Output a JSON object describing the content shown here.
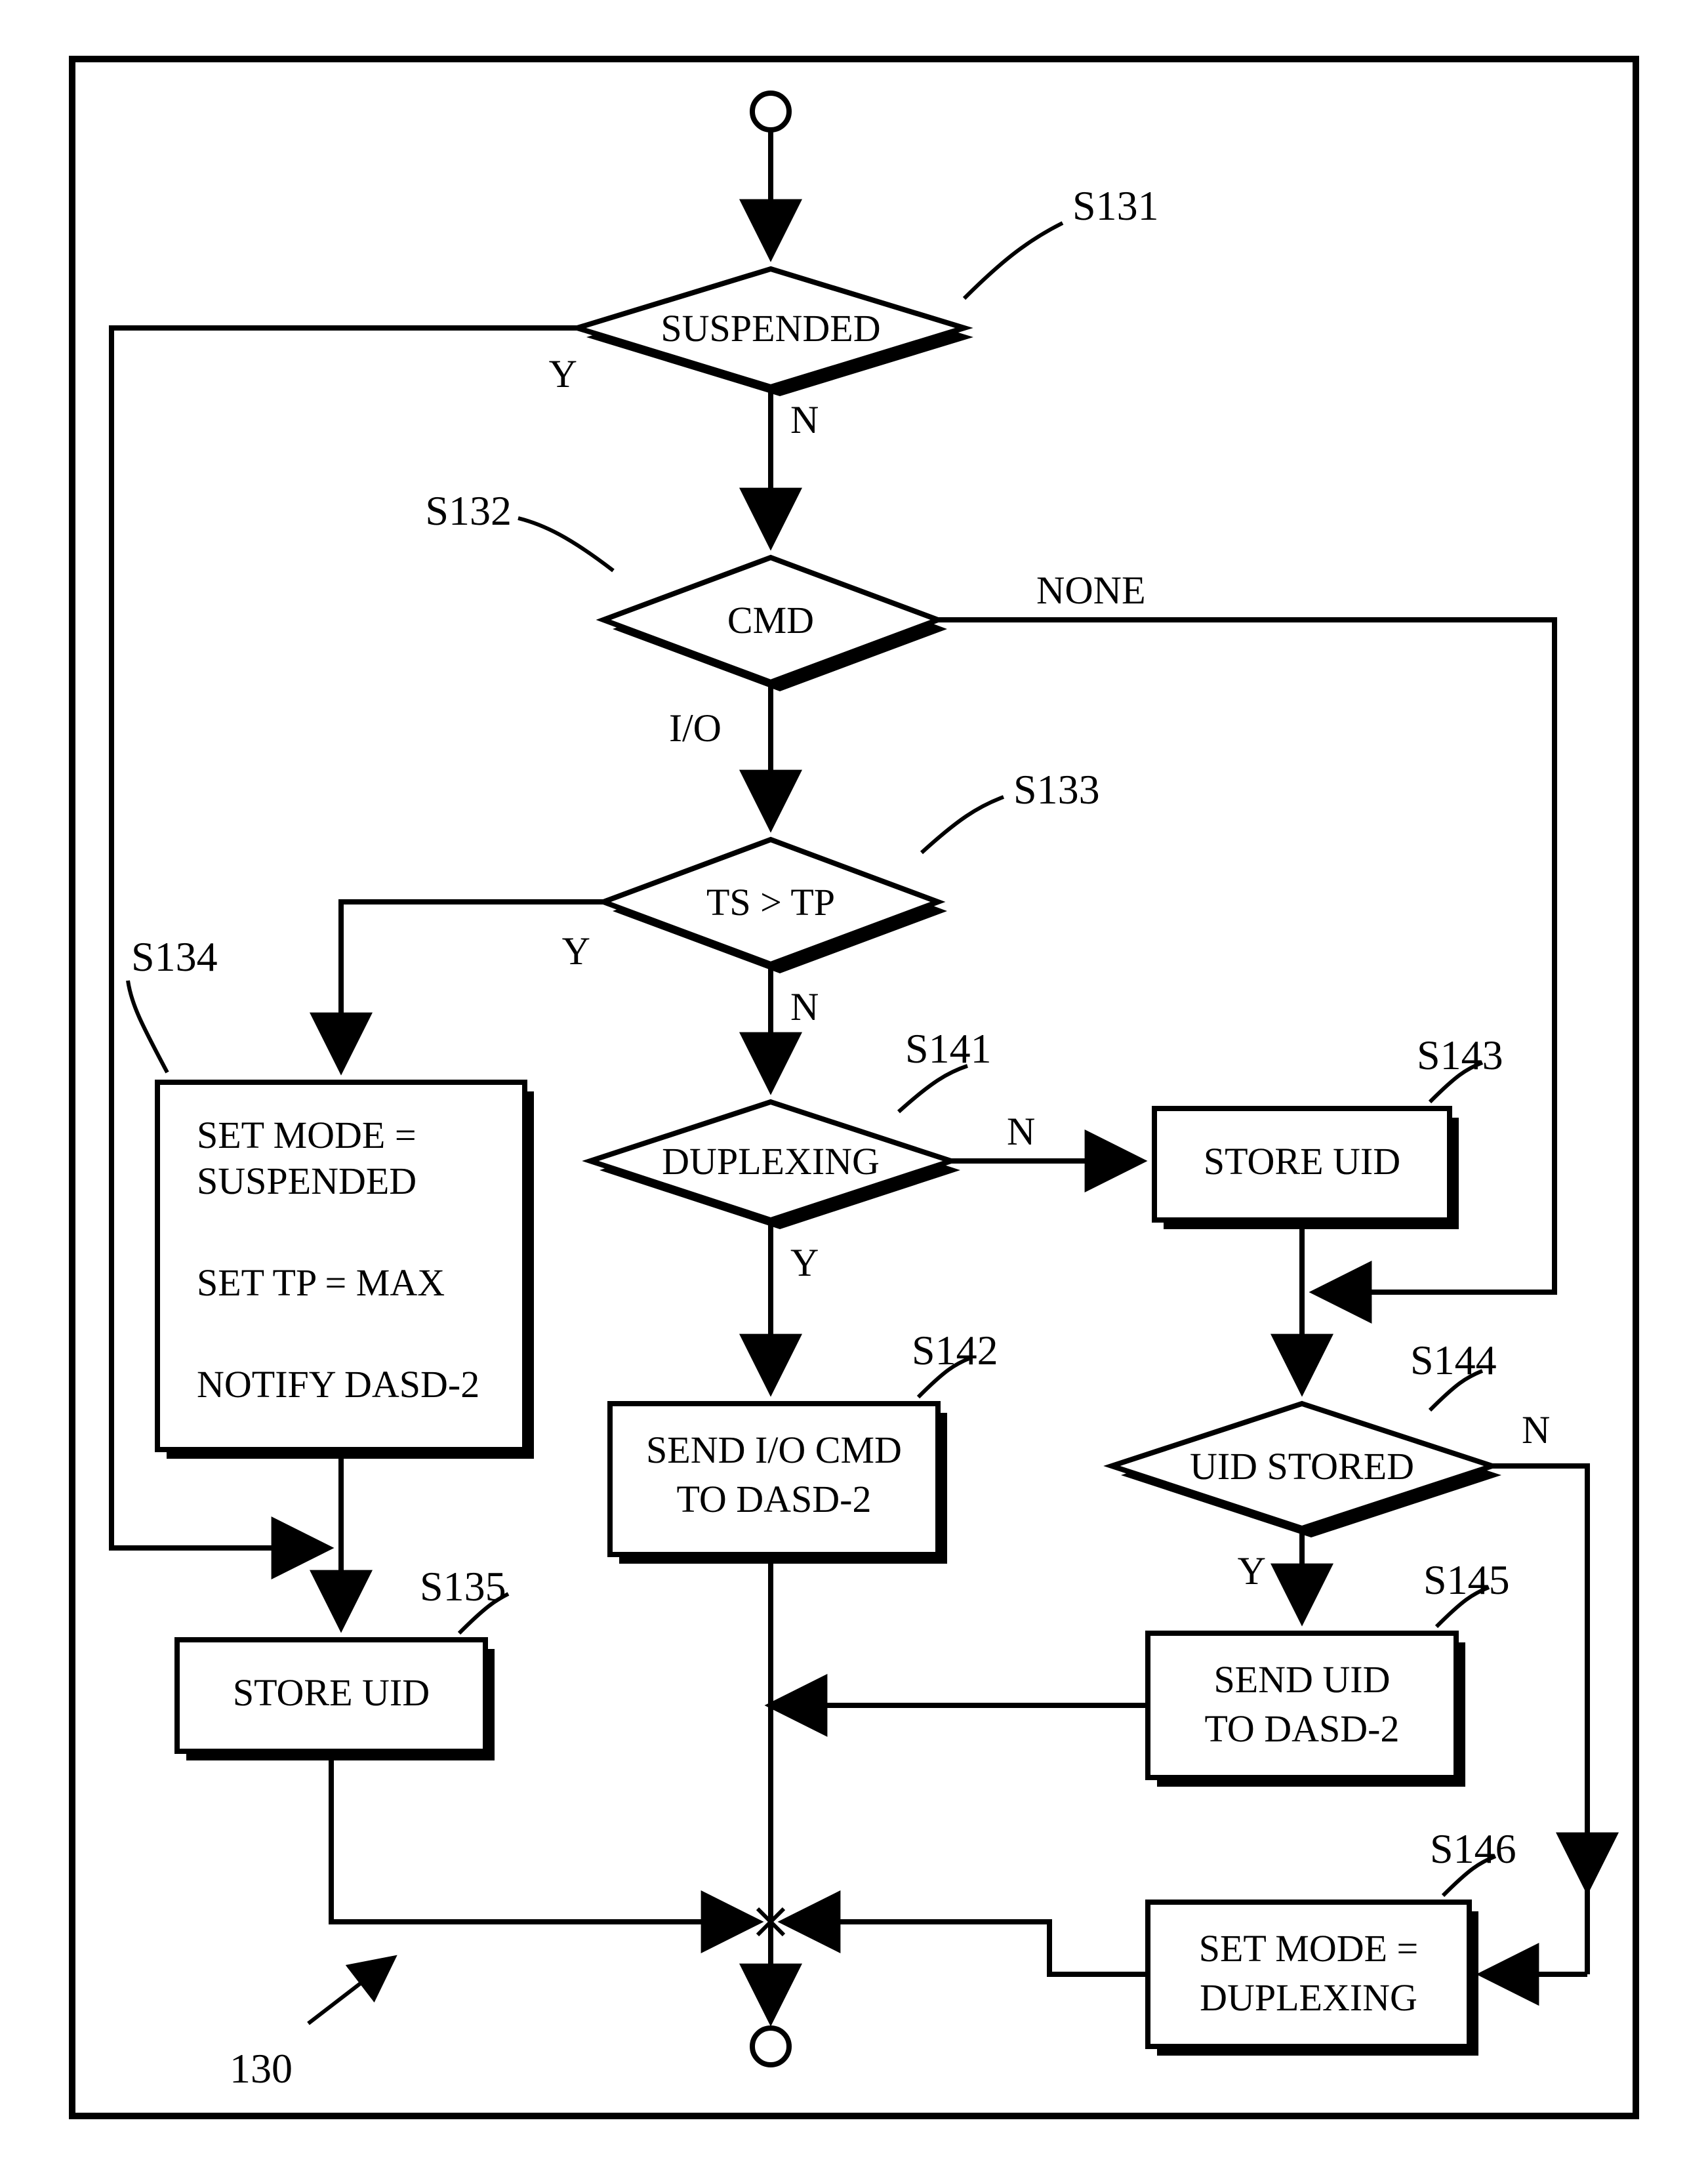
{
  "chart_data": {
    "type": "flowchart",
    "id_label": "130",
    "nodes": [
      {
        "id": "S131",
        "type": "decision",
        "text": "SUSPENDED"
      },
      {
        "id": "S132",
        "type": "decision",
        "text": "CMD"
      },
      {
        "id": "S133",
        "type": "decision",
        "text": "TS > TP"
      },
      {
        "id": "S134",
        "type": "process",
        "lines": [
          "SET MODE =",
          "SUSPENDED",
          "",
          "SET  TP = MAX",
          "",
          "NOTIFY  DASD-2"
        ]
      },
      {
        "id": "S135",
        "type": "process",
        "text": "STORE UID"
      },
      {
        "id": "S141",
        "type": "decision",
        "text": "DUPLEXING"
      },
      {
        "id": "S142",
        "type": "process",
        "lines": [
          "SEND I/O CMD",
          "TO DASD-2"
        ]
      },
      {
        "id": "S143",
        "type": "process",
        "text": "STORE UID"
      },
      {
        "id": "S144",
        "type": "decision",
        "text": "UID STORED"
      },
      {
        "id": "S145",
        "type": "process",
        "lines": [
          "SEND UID",
          "TO DASD-2"
        ]
      },
      {
        "id": "S146",
        "type": "process",
        "lines": [
          "SET MODE =",
          "DUPLEXING"
        ]
      }
    ],
    "edges": [
      {
        "from": "start",
        "to": "S131"
      },
      {
        "from": "S131",
        "label": "Y",
        "to": "join_S134_in"
      },
      {
        "from": "S131",
        "label": "N",
        "to": "S132"
      },
      {
        "from": "S132",
        "label": "NONE",
        "to": "S144_path"
      },
      {
        "from": "S132",
        "label": "I/O",
        "to": "S133"
      },
      {
        "from": "S133",
        "label": "Y",
        "to": "S134"
      },
      {
        "from": "S133",
        "label": "N",
        "to": "S141"
      },
      {
        "from": "S134",
        "to": "S135"
      },
      {
        "from": "S135",
        "to": "merge_end"
      },
      {
        "from": "S141",
        "label": "Y",
        "to": "S142"
      },
      {
        "from": "S141",
        "label": "N",
        "to": "S143"
      },
      {
        "from": "S142",
        "to": "merge_end"
      },
      {
        "from": "S143",
        "to": "S144"
      },
      {
        "from": "S144",
        "label": "Y",
        "to": "S145"
      },
      {
        "from": "S144",
        "label": "N",
        "to": "S146"
      },
      {
        "from": "S145",
        "to": "merge_end"
      },
      {
        "from": "S146",
        "to": "merge_end"
      },
      {
        "from": "merge_end",
        "to": "end"
      }
    ]
  },
  "labels": {
    "s131": "S131",
    "s132": "S132",
    "s133": "S133",
    "s134": "S134",
    "s135": "S135",
    "s141": "S141",
    "s142": "S142",
    "s143": "S143",
    "s144": "S144",
    "s145": "S145",
    "s146": "S146",
    "diagram_id": "130",
    "Y": "Y",
    "N": "N",
    "IO": "I/O",
    "NONE": "NONE"
  },
  "text": {
    "suspended": "SUSPENDED",
    "cmd": "CMD",
    "ts_tp": "TS > TP",
    "duplexing": "DUPLEXING",
    "uid_stored": "UID STORED",
    "s134_l1": "SET MODE =",
    "s134_l2": "SUSPENDED",
    "s134_l3": "SET  TP = MAX",
    "s134_l4": "NOTIFY  DASD-2",
    "store_uid": "STORE UID",
    "s142_l1": "SEND I/O CMD",
    "s142_l2": "TO DASD-2",
    "s145_l1": "SEND UID",
    "s145_l2": "TO DASD-2",
    "s146_l1": "SET  MODE =",
    "s146_l2": "DUPLEXING"
  }
}
